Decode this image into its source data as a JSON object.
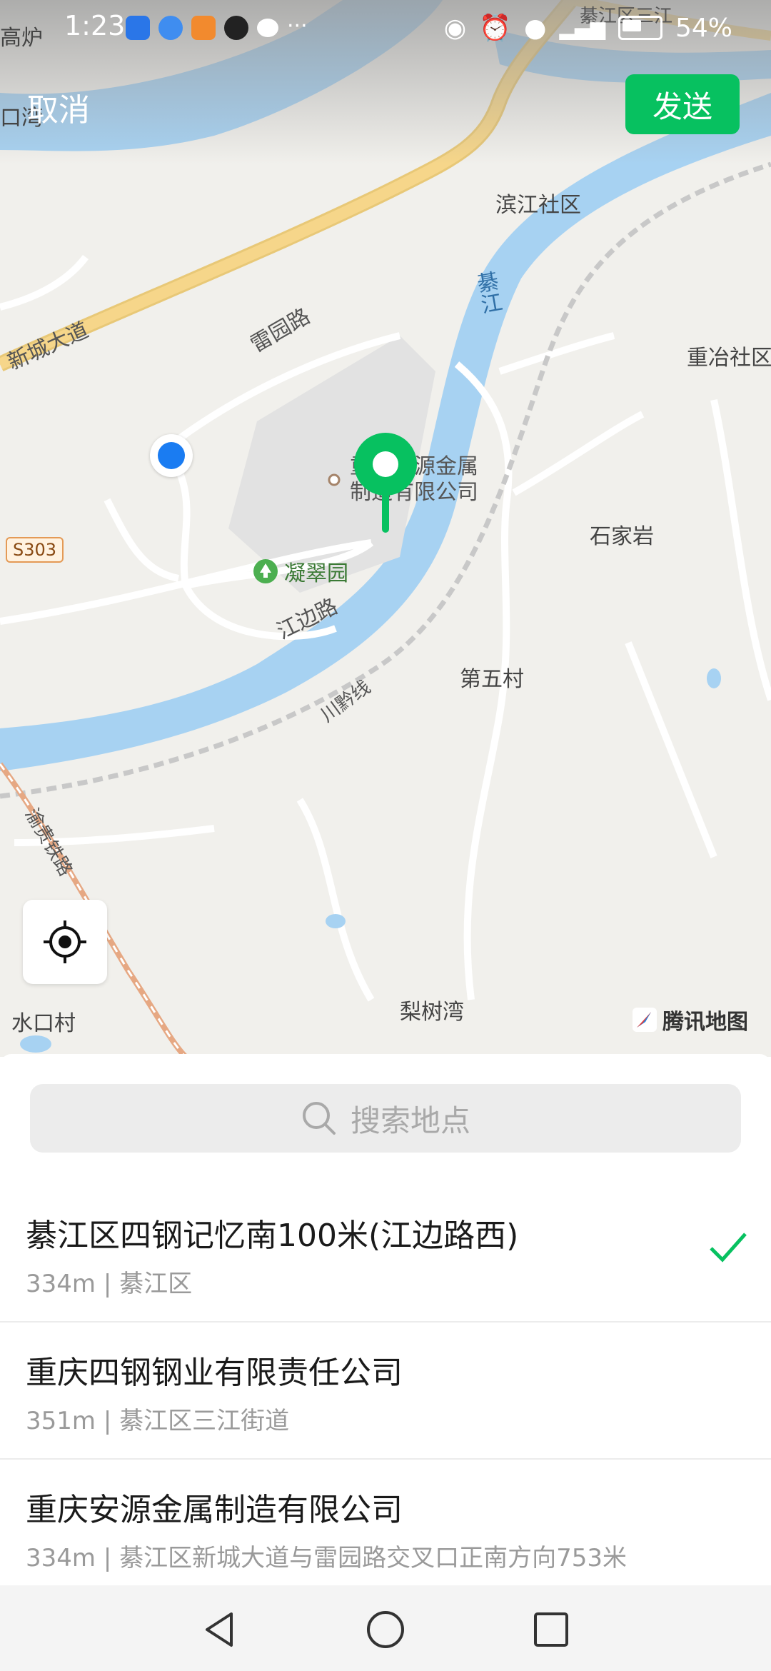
{
  "status_bar": {
    "time": "1:23",
    "battery": "54%",
    "corner_place": "綦江区三江"
  },
  "header": {
    "cancel_label": "取消",
    "send_label": "发送"
  },
  "map": {
    "places": [
      "高炉",
      "口湾",
      "滨江社区",
      "重冶社区",
      "石家岩",
      "第五村",
      "水口村",
      "梨树湾"
    ],
    "roads": [
      "新城大道",
      "雷园路",
      "江边路",
      "川黔线",
      "渝贵铁路"
    ],
    "river": "綦江",
    "highway_badge": "S303",
    "park": "凝翠园",
    "poi_line1": "重庆安源金属",
    "poi_line2": "制造有限公司",
    "brand": "腾讯地图",
    "colors": {
      "accent_green": "#07c160",
      "river": "#a7d2f2",
      "land": "#f1f0ec",
      "road_major": "#f6d68a",
      "user_dot": "#1a7cf2"
    }
  },
  "search": {
    "placeholder": "搜索地点"
  },
  "results": [
    {
      "title": "綦江区四钢记忆南100米(江边路西)",
      "distance": "334m",
      "address": "綦江区",
      "selected": true
    },
    {
      "title": "重庆四钢钢业有限责任公司",
      "distance": "351m",
      "address": "綦江区三江街道",
      "selected": false
    },
    {
      "title": "重庆安源金属制造有限公司",
      "distance": "334m",
      "address": "綦江区新城大道与雷园路交叉口正南方向753米",
      "selected": false
    }
  ],
  "separator": "|",
  "icons": {
    "locate": "locate-icon",
    "search": "search-icon",
    "check": "check-icon",
    "back": "back-icon",
    "home": "home-icon",
    "recents": "recents-icon"
  }
}
